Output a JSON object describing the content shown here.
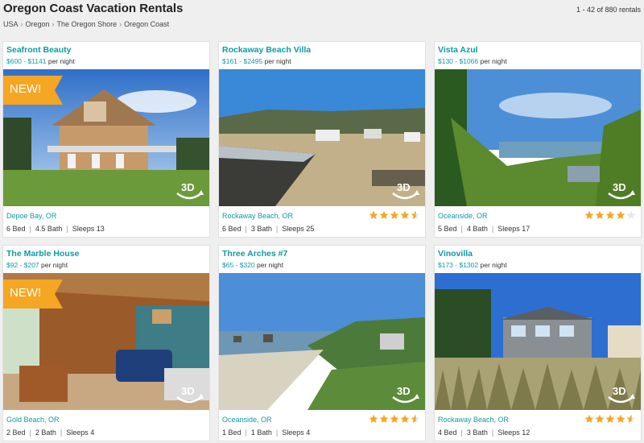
{
  "header": {
    "title": "Oregon Coast Vacation Rentals",
    "count": "1 - 42 of 880 rentals",
    "breadcrumb": [
      "USA",
      "Oregon",
      "The Oregon Shore",
      "Oregon Coast"
    ]
  },
  "badges": {
    "new": "NEW!",
    "tour": "3D"
  },
  "price_suffix": "per night",
  "listings": [
    {
      "name": "Seafront Beauty",
      "price": "$600 - $1141",
      "location": "Depoe Bay, OR",
      "bed": "6 Bed",
      "bath": "4.5 Bath",
      "sleeps": "Sleeps 13",
      "new": true,
      "rating": null
    },
    {
      "name": "Rockaway Beach Villa",
      "price": "$161 - $2495",
      "location": "Rockaway Beach, OR",
      "bed": "6 Bed",
      "bath": "3 Bath",
      "sleeps": "Sleeps 25",
      "new": false,
      "rating": 4.5
    },
    {
      "name": "Vista Azul",
      "price": "$130 - $1066",
      "location": "Oceanside, OR",
      "bed": "5 Bed",
      "bath": "4 Bath",
      "sleeps": "Sleeps 17",
      "new": false,
      "rating": 4
    },
    {
      "name": "The Marble House",
      "price": "$92 - $207",
      "location": "Gold Beach, OR",
      "bed": "2 Bed",
      "bath": "2 Bath",
      "sleeps": "Sleeps 4",
      "new": true,
      "rating": null
    },
    {
      "name": "Three Arches #7",
      "price": "$65 - $320",
      "location": "Oceanside, OR",
      "bed": "1 Bed",
      "bath": "1 Bath",
      "sleeps": "Sleeps 4",
      "new": false,
      "rating": 4.5
    },
    {
      "name": "Vinovilla",
      "price": "$173 - $1302",
      "location": "Rockaway Beach, OR",
      "bed": "4 Bed",
      "bath": "3 Bath",
      "sleeps": "Sleeps 12",
      "new": false,
      "rating": 4.5
    }
  ],
  "colors": {
    "accent": "#0e9aa7",
    "star": "#f5a623",
    "badge": "#f5a623"
  }
}
